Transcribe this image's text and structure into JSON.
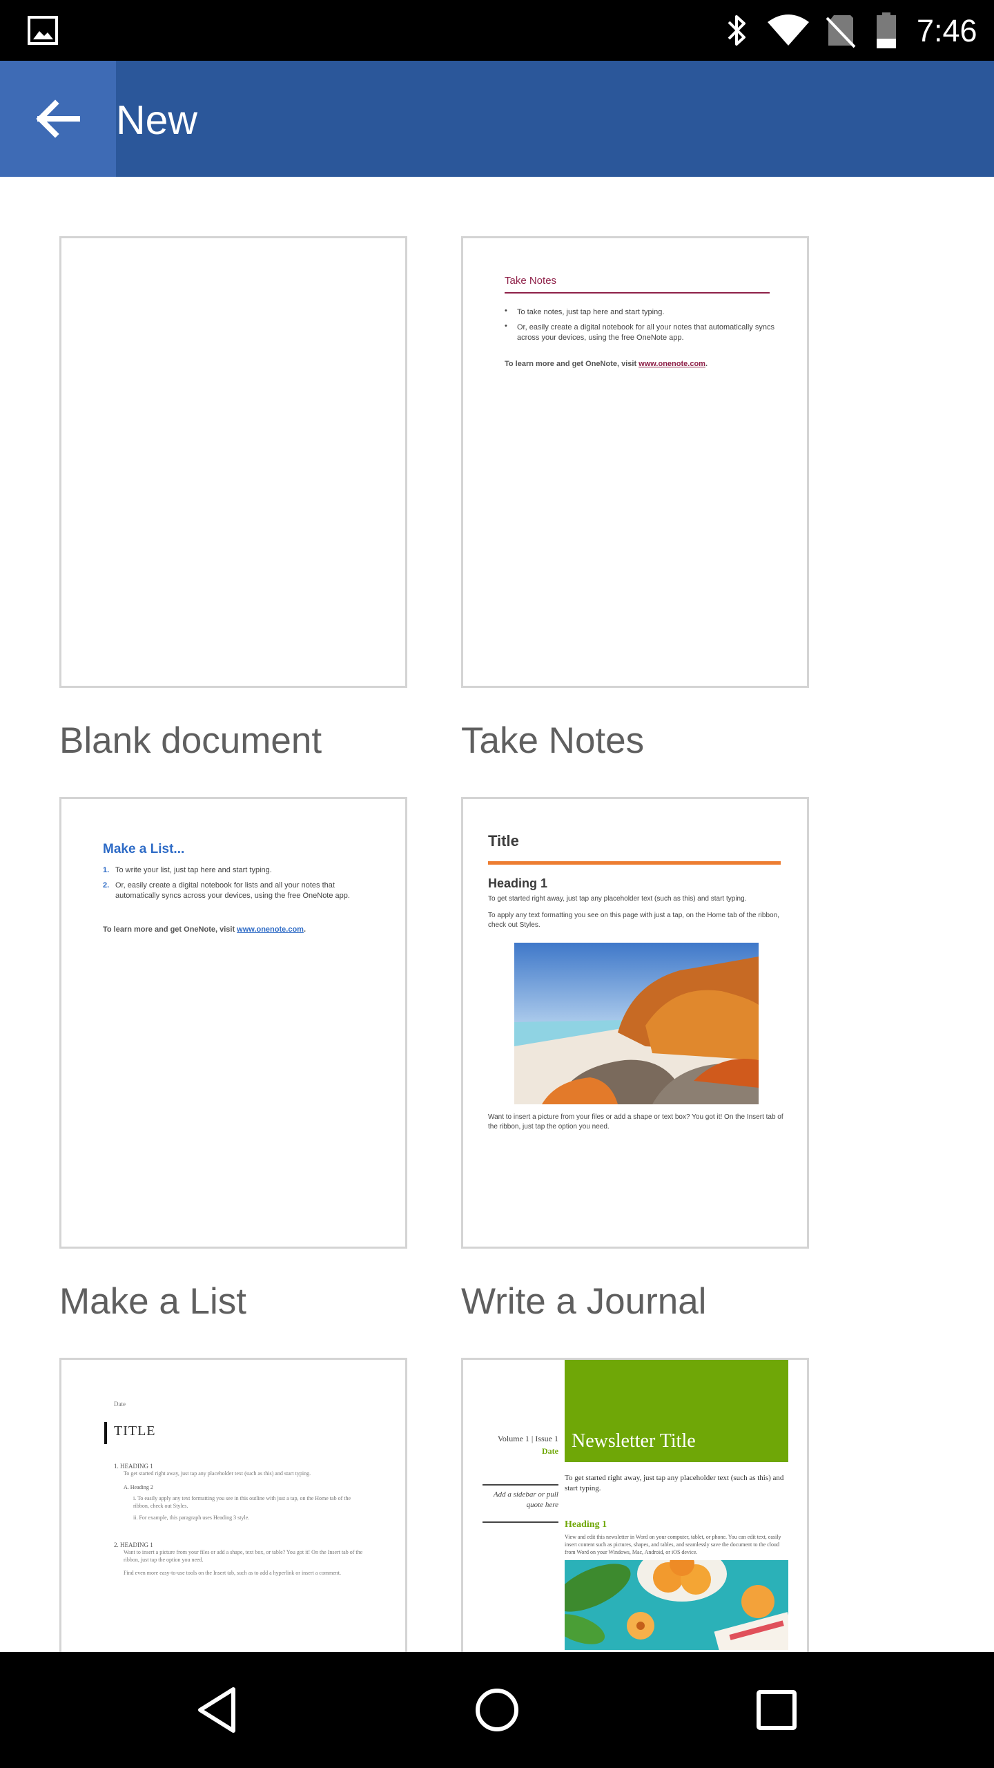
{
  "status_bar": {
    "time": "7:46",
    "icons": [
      "gallery-icon",
      "bluetooth-icon",
      "wifi-icon",
      "no-sim-icon",
      "battery-icon"
    ]
  },
  "app_bar": {
    "title": "New",
    "color": "#2b579a"
  },
  "templates": [
    {
      "label": "Blank document"
    },
    {
      "label": "Take Notes",
      "preview": {
        "heading": "Take Notes",
        "bullets": [
          "To take notes, just tap here and start typing.",
          "Or, easily create a digital notebook for all your notes that automatically syncs across your devices, using the free OneNote app."
        ],
        "footer_prefix": "To learn more and get OneNote, visit ",
        "footer_link": "www.onenote.com",
        "footer_suffix": "."
      }
    },
    {
      "label": "Make a List",
      "preview": {
        "heading": "Make a List...",
        "items": [
          "To write your list, just tap here and start typing.",
          "Or, easily create a digital notebook for lists and all your notes that automatically syncs across your devices, using the free OneNote app."
        ],
        "footer_prefix": "To learn more and get OneNote, visit ",
        "footer_link": "www.onenote.com",
        "footer_suffix": "."
      }
    },
    {
      "label": "Write a Journal",
      "preview": {
        "title": "Title",
        "heading": "Heading 1",
        "para1": "To get started right away, just tap any placeholder text (such as this) and start typing.",
        "para2": "To apply any text formatting you see on this page with just a tap, on the Home tab of the ribbon, check out Styles.",
        "para3": "Want to insert a picture from your files or add a shape or text box? You got it! On the Insert tab of the ribbon, just tap the option you need."
      }
    },
    {
      "label": "",
      "preview": {
        "date": "Date",
        "title": "TITLE",
        "h1a": "1.   HEADING 1",
        "p1": "To get started right away, just tap any placeholder text (such as this) and start typing.",
        "sub": "A.   Heading 2",
        "sub_i": "i.     To easily apply any text formatting you see in this outline with just a tap, on the Home tab of the ribbon, check out Styles.",
        "sub_ii": "ii.    For example, this paragraph uses Heading 3 style.",
        "h1b": "2.   HEADING 1",
        "p2": "Want to insert a picture from your files or add a shape, text box, or table? You got it! On the Insert tab of the ribbon, just tap the option you need.",
        "p3": "Find even more easy-to-use tools on the Insert tab, such as to add a hyperlink or insert a comment."
      }
    },
    {
      "label": "",
      "preview": {
        "volume": "Volume 1 | Issue 1",
        "date": "Date",
        "title": "Newsletter Title",
        "sidebar": "Add a sidebar or pull quote here",
        "intro": "To get started right away, just tap any placeholder text (such as this) and start typing.",
        "heading": "Heading 1",
        "body": "View and edit this newsletter in Word on your computer, tablet, or phone. You can edit text, easily insert content such as pictures, shapes, and tables, and seamlessly save the document to the cloud from Word on your Windows, Mac, Android, or iOS device."
      }
    }
  ],
  "colors": {
    "accent_blue": "#2b579a",
    "notes_maroon": "#8e2048",
    "list_blue": "#2e6bc6",
    "journal_orange": "#ed7d31",
    "newsletter_green": "#6fa707"
  }
}
